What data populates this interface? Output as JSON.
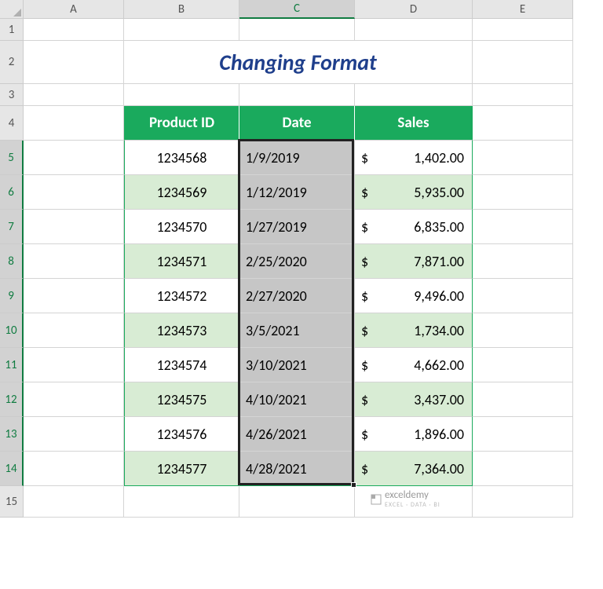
{
  "columns": [
    {
      "label": "A",
      "width": 128,
      "selected": false
    },
    {
      "label": "B",
      "width": 147,
      "selected": false
    },
    {
      "label": "C",
      "width": 147,
      "selected": true
    },
    {
      "label": "D",
      "width": 150,
      "selected": false
    },
    {
      "label": "E",
      "width": 128,
      "selected": false
    }
  ],
  "rows": [
    {
      "label": "1",
      "height": 28
    },
    {
      "label": "2",
      "height": 55
    },
    {
      "label": "3",
      "height": 28
    },
    {
      "label": "4",
      "height": 44
    },
    {
      "label": "5",
      "height": 44
    },
    {
      "label": "6",
      "height": 44
    },
    {
      "label": "7",
      "height": 44
    },
    {
      "label": "8",
      "height": 44
    },
    {
      "label": "9",
      "height": 44
    },
    {
      "label": "10",
      "height": 44
    },
    {
      "label": "11",
      "height": 44
    },
    {
      "label": "12",
      "height": 44
    },
    {
      "label": "13",
      "height": 44
    },
    {
      "label": "14",
      "height": 44
    },
    {
      "label": "15",
      "height": 40
    }
  ],
  "title": "Changing Format",
  "headers": {
    "product": "Product ID",
    "date": "Date",
    "sales": "Sales"
  },
  "data": [
    {
      "pid": "1234568",
      "date": "1/9/2019",
      "sales": "1,402.00"
    },
    {
      "pid": "1234569",
      "date": "1/12/2019",
      "sales": "5,935.00"
    },
    {
      "pid": "1234570",
      "date": "1/27/2019",
      "sales": "6,835.00"
    },
    {
      "pid": "1234571",
      "date": "2/25/2020",
      "sales": "7,871.00"
    },
    {
      "pid": "1234572",
      "date": "2/27/2020",
      "sales": "9,496.00"
    },
    {
      "pid": "1234573",
      "date": "3/5/2021",
      "sales": "1,734.00"
    },
    {
      "pid": "1234574",
      "date": "3/10/2021",
      "sales": "4,662.00"
    },
    {
      "pid": "1234575",
      "date": "4/10/2021",
      "sales": "3,437.00"
    },
    {
      "pid": "1234576",
      "date": "4/26/2021",
      "sales": "1,896.00"
    },
    {
      "pid": "1234577",
      "date": "4/28/2021",
      "sales": "7,364.00"
    }
  ],
  "currency": "$",
  "watermark": {
    "brand": "exceldemy",
    "tag": "EXCEL · DATA · BI"
  },
  "selected_rows": [
    "5",
    "6",
    "7",
    "8",
    "9",
    "10",
    "11",
    "12",
    "13",
    "14"
  ],
  "chart_data": {
    "type": "table",
    "title": "Changing Format",
    "columns": [
      "Product ID",
      "Date",
      "Sales"
    ],
    "rows": [
      [
        "1234568",
        "1/9/2019",
        1402.0
      ],
      [
        "1234569",
        "1/12/2019",
        5935.0
      ],
      [
        "1234570",
        "1/27/2019",
        6835.0
      ],
      [
        "1234571",
        "2/25/2020",
        7871.0
      ],
      [
        "1234572",
        "2/27/2020",
        9496.0
      ],
      [
        "1234573",
        "3/5/2021",
        1734.0
      ],
      [
        "1234574",
        "3/10/2021",
        4662.0
      ],
      [
        "1234575",
        "4/10/2021",
        3437.0
      ],
      [
        "1234576",
        "4/26/2021",
        1896.0
      ],
      [
        "1234577",
        "4/28/2021",
        7364.0
      ]
    ]
  }
}
